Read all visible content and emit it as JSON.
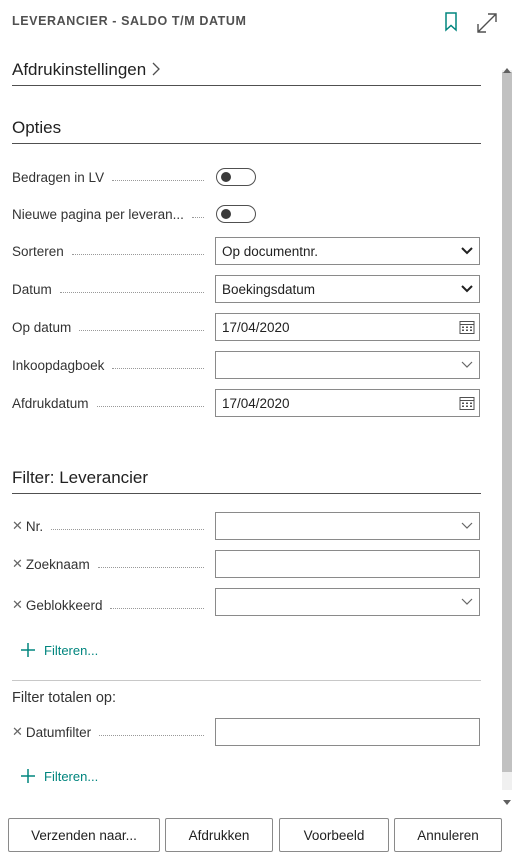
{
  "header": {
    "title": "LEVERANCIER - SALDO T/M DATUM"
  },
  "sections": {
    "print_settings": "Afdrukinstellingen",
    "options": "Opties",
    "filter_vendor": "Filter: Leverancier",
    "filter_totals": "Filter totalen op:"
  },
  "options": {
    "amounts_lcy_label": "Bedragen in LV",
    "amounts_lcy_on": false,
    "new_page_label": "Nieuwe pagina per leveran...",
    "new_page_on": false,
    "sort_label": "Sorteren",
    "sort_value": "Op documentnr.",
    "date_label": "Datum",
    "date_value": "Boekingsdatum",
    "as_of_label": "Op datum",
    "as_of_value": "17/04/2020",
    "journal_label": "Inkoopdagboek",
    "journal_value": "",
    "print_date_label": "Afdrukdatum",
    "print_date_value": "17/04/2020"
  },
  "vendor_filter": {
    "no_label": "Nr.",
    "no_value": "",
    "search_label": "Zoeknaam",
    "search_value": "",
    "blocked_label": "Geblokkeerd",
    "blocked_value": "",
    "add_filter": "Filteren..."
  },
  "totals_filter": {
    "date_filter_label": "Datumfilter",
    "date_filter_value": "",
    "add_filter": "Filteren..."
  },
  "footer": {
    "send_to": "Verzenden naar...",
    "print": "Afdrukken",
    "preview": "Voorbeeld",
    "cancel": "Annuleren"
  },
  "colors": {
    "accent": "#00857e",
    "border": "#8a8a8a"
  }
}
